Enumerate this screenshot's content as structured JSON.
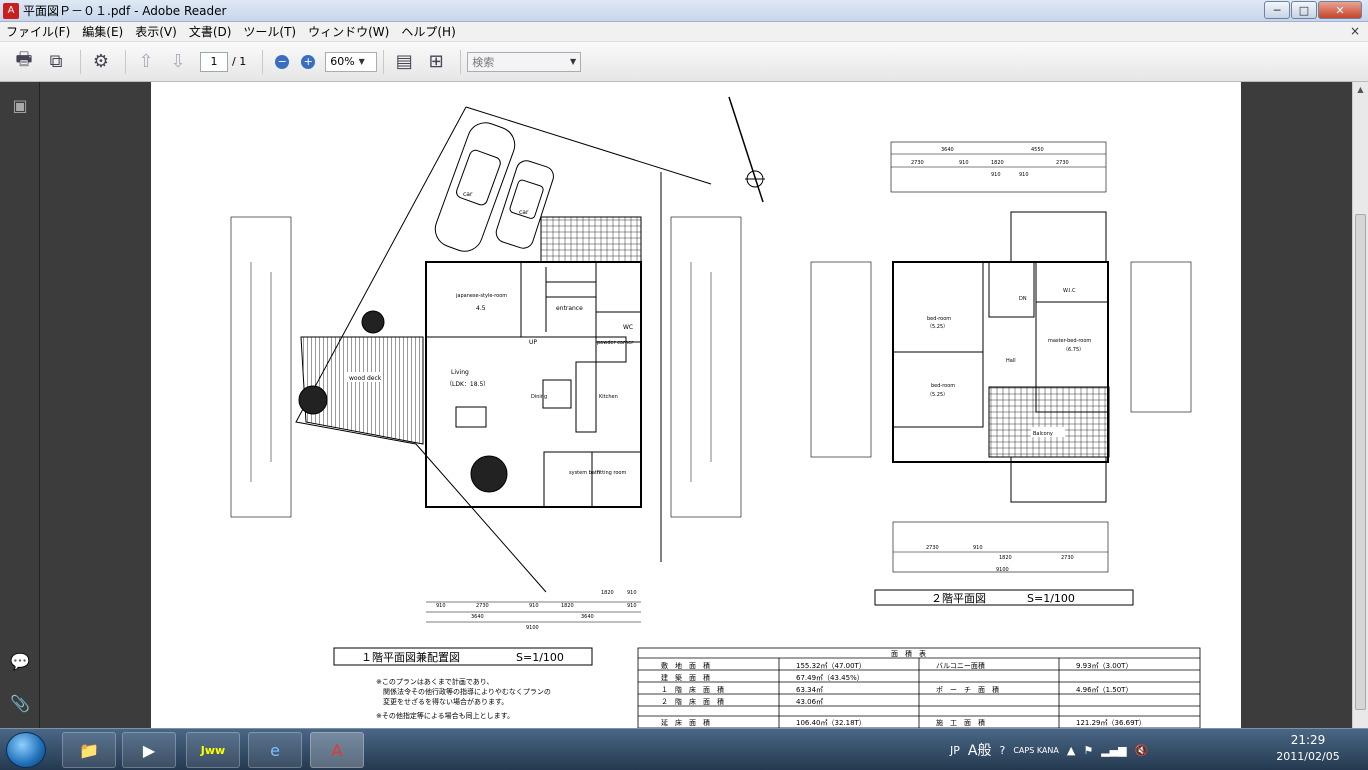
{
  "window": {
    "title": "平面図Ｐ－０１.pdf - Adobe Reader",
    "min": "─",
    "max": "□",
    "close": "✕"
  },
  "menu": {
    "items": [
      "ファイル(F)",
      "編集(E)",
      "表示(V)",
      "文書(D)",
      "ツール(T)",
      "ウィンドウ(W)",
      "ヘルプ(H)"
    ],
    "close": "×"
  },
  "toolbar": {
    "page_current": "1",
    "page_total": "/ 1",
    "zoom": "60%",
    "search_placeholder": "検索"
  },
  "drawing": {
    "floor1_title": "１階平面図兼配置図",
    "floor1_scale": "S=1/100",
    "floor2_title": "２階平面図",
    "floor2_scale": "S=1/100",
    "rooms1": [
      "car",
      "car",
      "japanese-style-room",
      "4.5",
      "entrance",
      "UP",
      "WC",
      "powder corner",
      "Living",
      "（LDK：18.5）",
      "Dining",
      "Kitchen",
      "wood deck",
      "system bath",
      "fitting room"
    ],
    "rooms2": [
      "bed-room",
      "（5.25）",
      "bed-room",
      "（5.25）",
      "DN",
      "W.I.C",
      "master-bed-room",
      "（6.75）",
      "Hall",
      "Balcony"
    ],
    "dims_top2": [
      "3640",
      "4550",
      "2730",
      "910",
      "1820",
      "2730",
      "910",
      "910"
    ],
    "dims_bottom2": [
      "2730",
      "910",
      "1820",
      "2730",
      "9100"
    ],
    "dims_bottom1": [
      "910",
      "2730",
      "910",
      "1820",
      "910",
      "3640",
      "3640",
      "9100",
      "1820",
      "910"
    ],
    "notes": [
      "※このプランはあくまで計画であり、",
      "　関係法令その他行政等の指導によりやむなくプランの",
      "　変更をせざるを得ない場合があります。",
      "※その他指定等による場合も同上とします。"
    ],
    "area_table": {
      "title": "面　積　表",
      "rows": [
        [
          "敷　地　面　積",
          "155.32㎡（47.00T）",
          "バルコニー面積",
          "9.93㎡（3.00T）"
        ],
        [
          "建　築　面　積",
          "67.49㎡（43.45%）",
          "",
          ""
        ],
        [
          "１　階　床　面　積",
          "63.34㎡",
          "ポ　ー　チ　面　積",
          "4.96㎡（1.50T）"
        ],
        [
          "２　階　床　面　積",
          "43.06㎡",
          "",
          ""
        ],
        [
          "延　床　面　積",
          "106.40㎡（32.18T）",
          "施　工　面　積",
          "121.29㎡（36.69T）"
        ]
      ]
    }
  },
  "taskbar": {
    "tasks": [
      "explorer",
      "media",
      "Jww",
      "ie",
      "reader"
    ],
    "tray": [
      "JP",
      "A般",
      "CAPS KANA"
    ],
    "time": "21:29",
    "date": "2011/02/05"
  }
}
